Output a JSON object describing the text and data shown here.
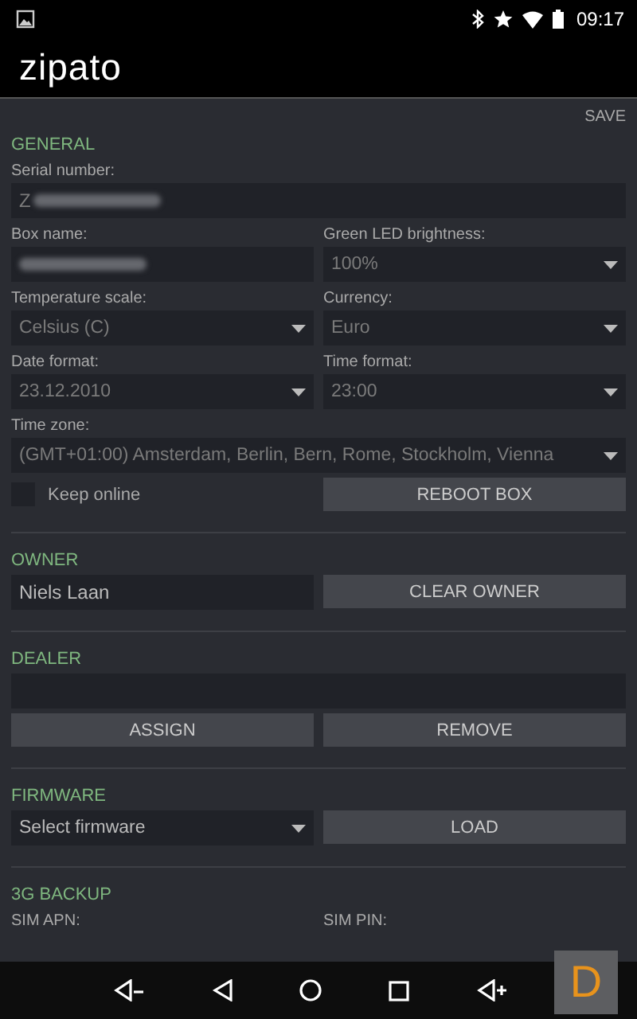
{
  "status_bar": {
    "time": "09:17"
  },
  "app_bar": {
    "logo": "zipato"
  },
  "save_action": "SAVE",
  "sections": [
    {
      "title": "GENERAL",
      "rows": [
        [
          {
            "kind": "input",
            "label": "Serial number:",
            "value": "Z",
            "redacted": true
          }
        ],
        [
          {
            "kind": "input",
            "label": "Box name:",
            "redacted": true
          },
          {
            "kind": "select",
            "label": "Green LED brightness:",
            "value": "100%"
          }
        ],
        [
          {
            "kind": "select",
            "label": "Temperature scale:",
            "value": "Celsius (C)"
          },
          {
            "kind": "select",
            "label": "Currency:",
            "value": "Euro"
          }
        ],
        [
          {
            "kind": "select",
            "label": "Date format:",
            "value": "23.12.2010"
          },
          {
            "kind": "select",
            "label": "Time format:",
            "value": "23:00"
          }
        ],
        [
          {
            "kind": "select",
            "label": "Time zone:",
            "value": "(GMT+01:00) Amsterdam, Berlin, Bern, Rome, Stockholm, Vienna"
          }
        ],
        [
          {
            "kind": "checkbox",
            "text": "Keep online",
            "checked": false
          },
          {
            "kind": "button",
            "text": "REBOOT BOX"
          }
        ]
      ]
    },
    {
      "title": "OWNER",
      "rows": [
        [
          {
            "kind": "input",
            "value": "Niels Laan"
          },
          {
            "kind": "button",
            "text": "CLEAR OWNER"
          }
        ]
      ]
    },
    {
      "title": "DEALER",
      "rows": [
        [
          {
            "kind": "input"
          }
        ],
        [
          {
            "kind": "button",
            "text": "ASSIGN"
          },
          {
            "kind": "button",
            "text": "REMOVE"
          }
        ]
      ]
    },
    {
      "title": "FIRMWARE",
      "rows": [
        [
          {
            "kind": "select",
            "placeholder": "Select firmware"
          },
          {
            "kind": "button",
            "text": "LOAD"
          }
        ]
      ]
    },
    {
      "title": "3G BACKUP",
      "rows": [
        [
          {
            "kind": "caption",
            "label": "SIM APN:"
          },
          {
            "kind": "caption",
            "label": "SIM PIN:"
          }
        ]
      ]
    }
  ],
  "overlay_button": "D"
}
